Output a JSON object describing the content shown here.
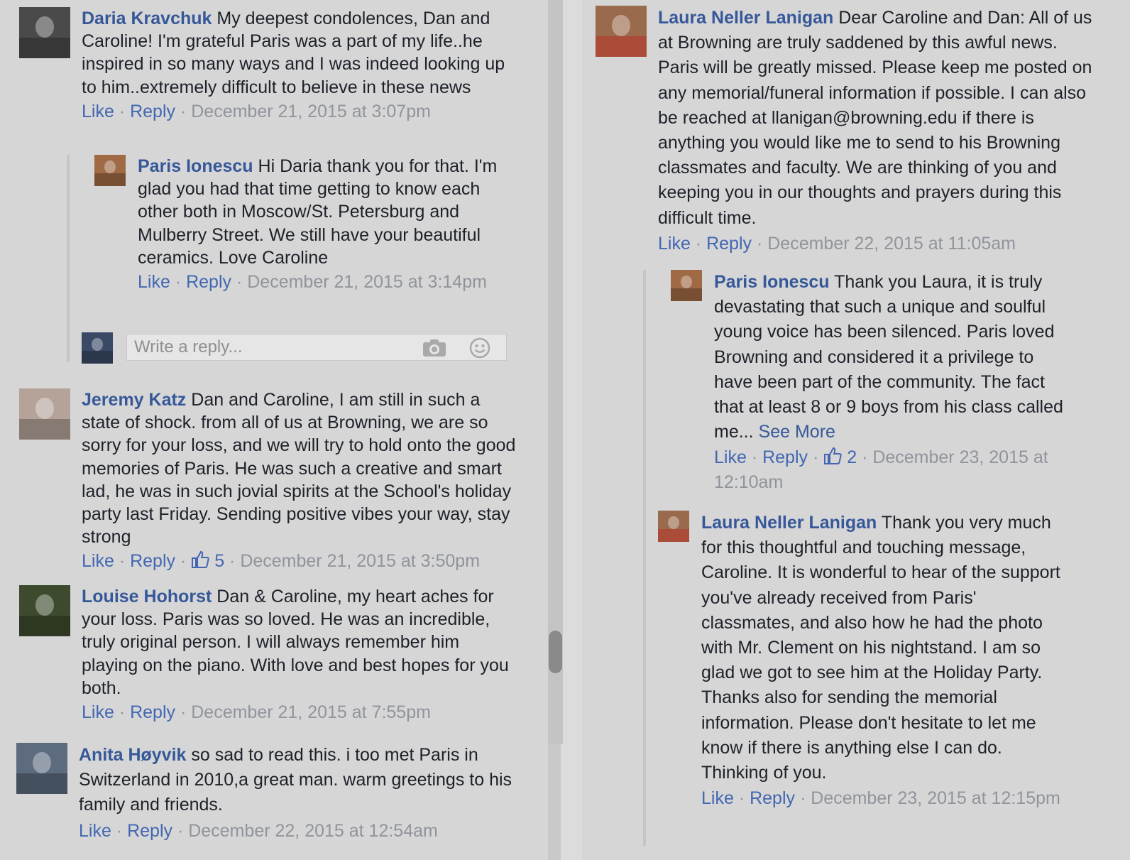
{
  "left": {
    "comments": [
      {
        "author": "Daria Kravchuk",
        "text": "My deepest condolences, Dan and Caroline! I'm grateful Paris was a part of my life..he inspired in so many ways and I was indeed looking up to him..extremely difficult to believe in these news",
        "like": "Like",
        "reply": "Reply",
        "sep": " · ",
        "timestamp": "December 21, 2015 at 3:07pm"
      },
      {
        "author": "Paris Ionescu",
        "text": "Hi Daria thank you for that. I'm glad you had that time getting to know each other both in Moscow/St. Petersburg and Mulberry Street. We still have your beautiful ceramics. Love Caroline",
        "like": "Like",
        "reply": "Reply",
        "sep": " · ",
        "timestamp": "December 21, 2015 at 3:14pm"
      },
      {
        "author": "Jeremy Katz",
        "text": "Dan and Caroline, I am still in such a state of shock. from all of us at Browning, we are so sorry for your loss, and we will try to hold onto the good memories of Paris. He was such a creative and smart lad, he was in such jovial spirits at the School's holiday party last Friday. Sending positive vibes your way, stay strong",
        "like": "Like",
        "reply": "Reply",
        "sep": " · ",
        "like_count": "5",
        "timestamp": "December 21, 2015 at 3:50pm"
      },
      {
        "author": "Louise Hohorst",
        "text": "Dan & Caroline, my heart aches for your loss. Paris was so loved. He was an incredible, truly original person. I will always remember him playing on the piano. With love and best hopes for you both.",
        "like": "Like",
        "reply": "Reply",
        "sep": " · ",
        "timestamp": "December 21, 2015 at 7:55pm"
      },
      {
        "author": "Anita Høyvik",
        "text": "so sad to read this. i too met Paris in Switzerland in 2010,a great man. warm greetings to his family and friends.",
        "like": "Like",
        "reply": "Reply",
        "sep": " · ",
        "timestamp": "December 22, 2015 at 12:54am"
      }
    ],
    "reply_box": {
      "placeholder": "Write a reply..."
    }
  },
  "right": {
    "comments": [
      {
        "author": "Laura Neller Lanigan",
        "text": "Dear Caroline and Dan: All of us at Browning are truly saddened by this awful news. Paris will be greatly missed. Please keep me posted on any memorial/funeral information if possible. I can also be reached at llanigan@browning.edu if there is anything you would like me to send to his Browning classmates and faculty. We are thinking of you and keeping you in our thoughts and prayers during this difficult time.",
        "like": "Like",
        "reply": "Reply",
        "sep": " · ",
        "timestamp": "December 22, 2015 at 11:05am"
      },
      {
        "author": "Paris Ionescu",
        "text": "Thank you Laura, it is truly devastating that such a unique and soulful young voice has been silenced. Paris loved Browning and considered it a privilege to have been part of the community. The fact that at least 8 or 9 boys from his class called me...",
        "see_more": "See More",
        "like": "Like",
        "reply": "Reply",
        "sep": " · ",
        "like_count": "2",
        "timestamp": "December 23, 2015 at 12:10am"
      },
      {
        "author": "Laura Neller Lanigan",
        "text": "Thank you very much for this thoughtful and touching message, Caroline. It is wonderful to hear of the support you've already received from Paris' classmates, and also how he had the photo with Mr. Clement on his nightstand. I am so glad we got to see him at the Holiday Party. Thanks also for sending the memorial information. Please don't hesitate to let me know if there is anything else I can do. Thinking of you.",
        "like": "Like",
        "reply": "Reply",
        "sep": " · ",
        "timestamp": "December 23, 2015 at 12:15pm"
      }
    ]
  },
  "colors": {
    "author": "#365899",
    "link": "#4267b2",
    "meta": "#90949c",
    "background": "#d6d6d6"
  },
  "icons": [
    "camera-icon",
    "emoji-icon",
    "thumbs-up-icon"
  ]
}
